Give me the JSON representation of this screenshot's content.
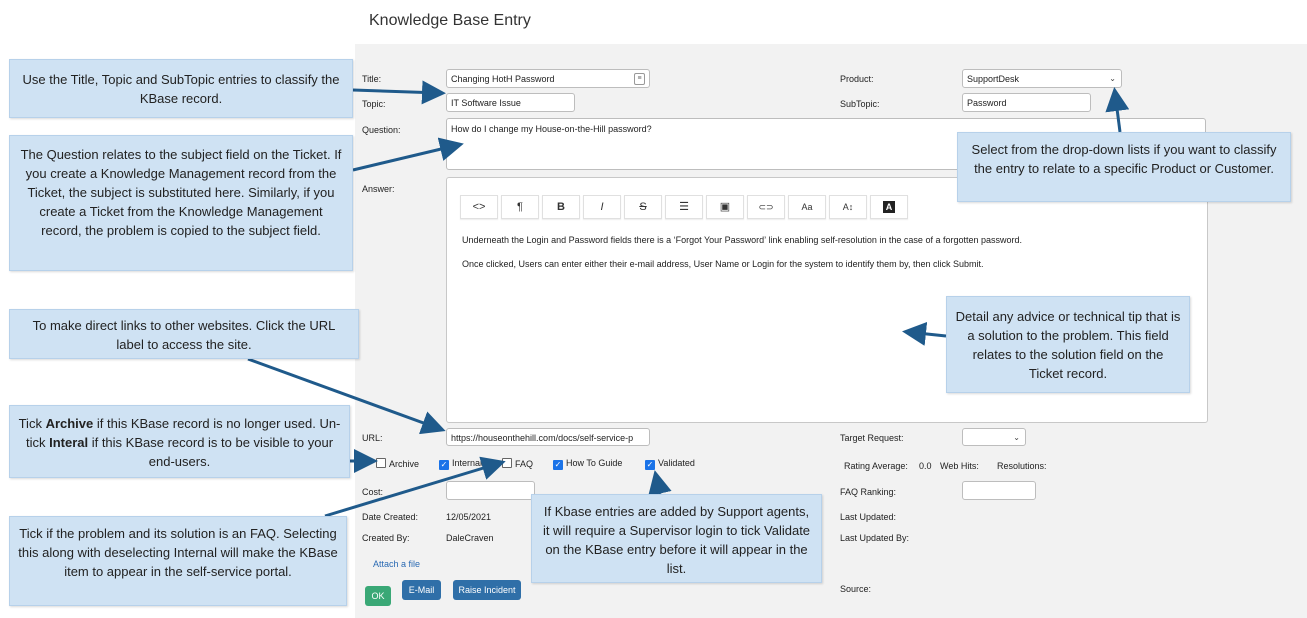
{
  "page_title": "Knowledge Base Entry",
  "labels": {
    "title": "Title:",
    "topic": "Topic:",
    "question": "Question:",
    "answer": "Answer:",
    "url": "URL:",
    "cost": "Cost:",
    "date_created": "Date Created:",
    "created_by": "Created By:",
    "product": "Product:",
    "subtopic": "SubTopic:",
    "target_request": "Target Request:",
    "rating_average": "Rating Average:",
    "web_hits": "Web Hits:",
    "resolutions": "Resolutions:",
    "faq_ranking": "FAQ Ranking:",
    "last_updated": "Last Updated:",
    "last_updated_by": "Last Updated By:",
    "source": "Source:"
  },
  "values": {
    "title": "Changing HotH Password",
    "topic": "IT Software Issue",
    "question": "How do I change my House-on-the-Hill password?",
    "url": "https://houseonthehill.com/docs/self-service-p",
    "cost": "",
    "date_created": "12/05/2021",
    "created_by": "DaleCraven",
    "product": "SupportDesk",
    "subtopic": "Password",
    "target_request": "",
    "rating_average": "0.0",
    "faq_ranking": ""
  },
  "answer_lines": [
    "Underneath the Login and Password fields there is a ‘Forgot Your Password’ link enabling self-resolution in the case of a forgotten password.",
    "Once clicked, Users can enter either their e-mail address, User Name or Login for the system to identify them by, then click Submit."
  ],
  "toolbar": [
    {
      "icon": "code-icon",
      "glyph": "<>"
    },
    {
      "icon": "paragraph-icon",
      "glyph": "¶"
    },
    {
      "icon": "bold-icon",
      "glyph": "B"
    },
    {
      "icon": "italic-icon",
      "glyph": "I"
    },
    {
      "icon": "strikethrough-icon",
      "glyph": "S"
    },
    {
      "icon": "list-icon",
      "glyph": "☰"
    },
    {
      "icon": "image-icon",
      "glyph": "▣"
    },
    {
      "icon": "link-icon",
      "glyph": "⊂⊃"
    },
    {
      "icon": "font-size-icon",
      "glyph": "Aa"
    },
    {
      "icon": "line-height-icon",
      "glyph": "A↕"
    },
    {
      "icon": "font-color-icon",
      "glyph": "A"
    }
  ],
  "checkboxes": {
    "archive": {
      "label": "Archive",
      "checked": false
    },
    "internal": {
      "label": "Internal",
      "checked": true
    },
    "faq": {
      "label": "FAQ",
      "checked": false
    },
    "how_to_guide": {
      "label": "How To Guide",
      "checked": true
    },
    "validated": {
      "label": "Validated",
      "checked": true
    }
  },
  "links": {
    "attach_file": "Attach a file"
  },
  "buttons": {
    "ok": "OK",
    "email": "E-Mail",
    "raise_incident": "Raise Incident"
  },
  "colors": {
    "ok": "#3aa876",
    "action": "#2f6fa8",
    "callout": "#cfe2f3",
    "arrow": "#1f5a8b"
  },
  "callouts": {
    "classify": "Use the Title, Topic and SubTopic entries to classify the KBase record.",
    "question": "The Question relates to the subject field on the Ticket. If you create a Knowledge Management record from the Ticket, the subject is substituted here. Similarly, if you create a Ticket from the Knowledge Management record, the problem is copied to the subject field.",
    "url": "To make direct links to other websites. Click the URL label to access the site.",
    "archive_pre": "Tick ",
    "archive_b1": "Archive",
    "archive_mid": " if this KBase record is no longer used. Un-tick ",
    "archive_b2": "Interal",
    "archive_post": " if this KBase record is to be visible to your end-users.",
    "faq": "Tick if the problem and its solution is an FAQ. Selecting this along with deselecting Internal will make the KBase item to appear in the self-service portal.",
    "product": "Select from the drop-down lists if you want to classify the entry to relate to a specific Product or Customer.",
    "answer": "Detail any advice or technical tip that is a solution to the problem. This field relates to the solution field on the Ticket record.",
    "validate": "If Kbase entries are added by Support agents, it will require a Supervisor login to tick Validate on the KBase entry before it will appear in the list."
  }
}
